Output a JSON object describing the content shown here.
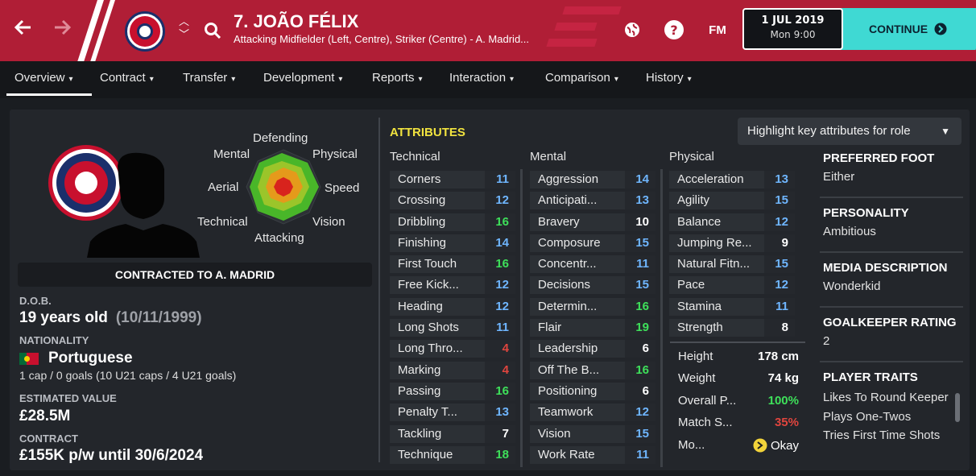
{
  "header": {
    "title": "7. JOÃO FÉLIX",
    "subtitle": "Attacking Midfielder (Left, Centre), Striker (Centre) - A. Madrid...",
    "date": "1 JUL 2019",
    "time": "Mon 9:00",
    "continue_label": "CONTINUE",
    "fm_label": "FM",
    "help_label": "?",
    "accent_color": "#b01e36",
    "continue_color": "#3fd9d3"
  },
  "tabs": [
    {
      "label": "Overview"
    },
    {
      "label": "Contract"
    },
    {
      "label": "Transfer"
    },
    {
      "label": "Development"
    },
    {
      "label": "Reports"
    },
    {
      "label": "Interaction"
    },
    {
      "label": "Comparison"
    },
    {
      "label": "History"
    }
  ],
  "profile": {
    "contract_banner": "CONTRACTED TO A. MADRID",
    "dob_label": "D.O.B.",
    "age": "19 years old",
    "dob": "(10/11/1999)",
    "nationality_label": "NATIONALITY",
    "nationality": "Portuguese",
    "caps": "1 cap / 0 goals (10 U21 caps / 4 U21 goals)",
    "value_label": "ESTIMATED VALUE",
    "value": "£28.5M",
    "contract_label": "CONTRACT",
    "contract": "£155K p/w until 30/6/2024"
  },
  "radar": {
    "labels": [
      "Defending",
      "Physical",
      "Speed",
      "Vision",
      "Attacking",
      "Technical",
      "Aerial",
      "Mental"
    ]
  },
  "attributes": {
    "heading": "ATTRIBUTES",
    "highlight_label": "Highlight key attributes for role",
    "technical_label": "Technical",
    "mental_label": "Mental",
    "physical_label": "Physical",
    "technical": [
      {
        "name": "Corners",
        "value": "11",
        "color": "#6fb6ff"
      },
      {
        "name": "Crossing",
        "value": "12",
        "color": "#6fb6ff"
      },
      {
        "name": "Dribbling",
        "value": "16",
        "color": "#3ee05a"
      },
      {
        "name": "Finishing",
        "value": "14",
        "color": "#6fb6ff"
      },
      {
        "name": "First Touch",
        "value": "16",
        "color": "#3ee05a"
      },
      {
        "name": "Free Kick...",
        "value": "12",
        "color": "#6fb6ff"
      },
      {
        "name": "Heading",
        "value": "12",
        "color": "#6fb6ff"
      },
      {
        "name": "Long Shots",
        "value": "11",
        "color": "#6fb6ff"
      },
      {
        "name": "Long Thro...",
        "value": "4",
        "color": "#e0453e"
      },
      {
        "name": "Marking",
        "value": "4",
        "color": "#e0453e"
      },
      {
        "name": "Passing",
        "value": "16",
        "color": "#3ee05a"
      },
      {
        "name": "Penalty T...",
        "value": "13",
        "color": "#6fb6ff"
      },
      {
        "name": "Tackling",
        "value": "7",
        "color": "#ffffff"
      },
      {
        "name": "Technique",
        "value": "18",
        "color": "#3ee05a"
      }
    ],
    "mental": [
      {
        "name": "Aggression",
        "value": "14",
        "color": "#6fb6ff"
      },
      {
        "name": "Anticipati...",
        "value": "13",
        "color": "#6fb6ff"
      },
      {
        "name": "Bravery",
        "value": "10",
        "color": "#ffffff"
      },
      {
        "name": "Composure",
        "value": "15",
        "color": "#6fb6ff"
      },
      {
        "name": "Concentr...",
        "value": "11",
        "color": "#6fb6ff"
      },
      {
        "name": "Decisions",
        "value": "15",
        "color": "#6fb6ff"
      },
      {
        "name": "Determin...",
        "value": "16",
        "color": "#3ee05a"
      },
      {
        "name": "Flair",
        "value": "19",
        "color": "#3ee05a"
      },
      {
        "name": "Leadership",
        "value": "6",
        "color": "#ffffff"
      },
      {
        "name": "Off The B...",
        "value": "16",
        "color": "#3ee05a"
      },
      {
        "name": "Positioning",
        "value": "6",
        "color": "#ffffff"
      },
      {
        "name": "Teamwork",
        "value": "12",
        "color": "#6fb6ff"
      },
      {
        "name": "Vision",
        "value": "15",
        "color": "#6fb6ff"
      },
      {
        "name": "Work Rate",
        "value": "11",
        "color": "#6fb6ff"
      }
    ],
    "physical": [
      {
        "name": "Acceleration",
        "value": "13",
        "color": "#6fb6ff"
      },
      {
        "name": "Agility",
        "value": "15",
        "color": "#6fb6ff"
      },
      {
        "name": "Balance",
        "value": "12",
        "color": "#6fb6ff"
      },
      {
        "name": "Jumping Re...",
        "value": "9",
        "color": "#ffffff"
      },
      {
        "name": "Natural Fitn...",
        "value": "15",
        "color": "#6fb6ff"
      },
      {
        "name": "Pace",
        "value": "12",
        "color": "#6fb6ff"
      },
      {
        "name": "Stamina",
        "value": "11",
        "color": "#6fb6ff"
      },
      {
        "name": "Strength",
        "value": "8",
        "color": "#ffffff"
      }
    ],
    "physical_extra": [
      {
        "name": "Height",
        "value": "178 cm",
        "color": "#ffffff"
      },
      {
        "name": "Weight",
        "value": "74 kg",
        "color": "#ffffff"
      },
      {
        "name": "Overall P...",
        "value": "100%",
        "color": "#3ee05a"
      },
      {
        "name": "Match S...",
        "value": "35%",
        "color": "#e0453e"
      },
      {
        "name": "Mo...",
        "value": "Okay",
        "color": "#f2d33a"
      }
    ]
  },
  "info": {
    "foot_label": "PREFERRED FOOT",
    "foot": "Either",
    "personality_label": "PERSONALITY",
    "personality": "Ambitious",
    "media_label": "MEDIA DESCRIPTION",
    "media": "Wonderkid",
    "gk_label": "GOALKEEPER RATING",
    "gk": "2",
    "traits_label": "PLAYER TRAITS",
    "traits": [
      "Likes To Round Keeper",
      "Plays One-Twos",
      "Tries First Time Shots"
    ]
  }
}
